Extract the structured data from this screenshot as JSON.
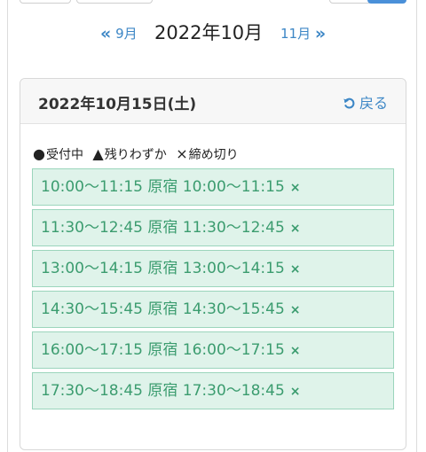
{
  "month_nav": {
    "prev_label": "9月",
    "prev_arrows": "«",
    "current_label": "2022年10月",
    "next_label": "11月",
    "next_arrows": "»"
  },
  "day": {
    "title": "2022年10月15日(土)",
    "back_label": "戻る"
  },
  "legend": [
    {
      "symbol": "●",
      "label": "受付中"
    },
    {
      "symbol": "▲",
      "label": "残りわずか"
    },
    {
      "symbol": "×",
      "label": "締め切り"
    }
  ],
  "slots": [
    {
      "text": "10:00〜11:15 原宿 10:00〜11:15",
      "status": "×"
    },
    {
      "text": "11:30〜12:45 原宿 11:30〜12:45",
      "status": "×"
    },
    {
      "text": "13:00〜14:15 原宿 13:00〜14:15",
      "status": "×"
    },
    {
      "text": "14:30〜15:45 原宿 14:30〜15:45",
      "status": "×"
    },
    {
      "text": "16:00〜17:15 原宿 16:00〜17:15",
      "status": "×"
    },
    {
      "text": "17:30〜18:45 原宿 17:30〜18:45",
      "status": "×"
    }
  ],
  "colors": {
    "accent": "#3d87c6",
    "slot_bg": "#dff3ea",
    "slot_border": "#9bd5bc",
    "slot_text": "#3b9c6f"
  }
}
